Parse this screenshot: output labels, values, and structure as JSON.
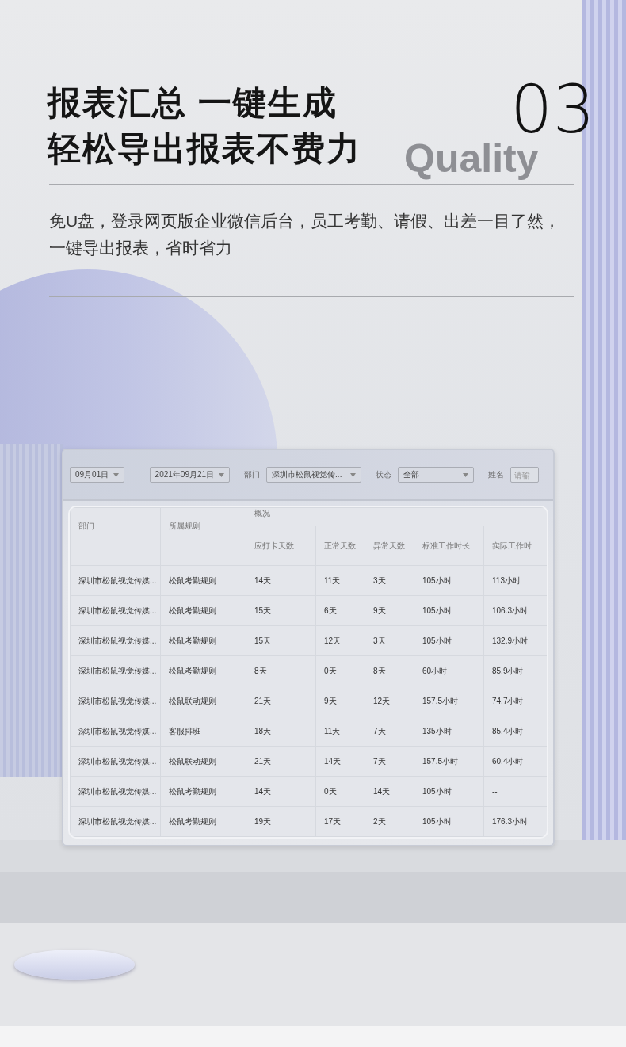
{
  "headline": {
    "lines": [
      "报表汇总 一键生成",
      "轻松导出报表不费力"
    ],
    "number": "03",
    "backdrop_word": "Quality"
  },
  "description": "免U盘，登录网页版企业微信后台，员工考勤、请假、出差一目了然，一键导出报表，省时省力",
  "filters": [
    {
      "kind": "select",
      "value": "09月01日"
    },
    {
      "kind": "separator",
      "text": "-"
    },
    {
      "kind": "select",
      "value": "2021年09月21日"
    },
    {
      "kind": "label",
      "text": "部门"
    },
    {
      "kind": "select",
      "value": "深圳市松鼠视觉传..."
    },
    {
      "kind": "label",
      "text": "状态"
    },
    {
      "kind": "select",
      "value": "全部"
    },
    {
      "kind": "label",
      "text": "姓名"
    },
    {
      "kind": "input",
      "placeholder": "请输"
    }
  ],
  "table": {
    "group_header": "概况",
    "columns": [
      "部门",
      "所属规则",
      "应打卡天数",
      "正常天数",
      "异常天数",
      "标准工作时长",
      "实际工作时"
    ],
    "rows": [
      [
        "深圳市松鼠视觉传媒...",
        "松鼠考勤规则",
        "14天",
        "11天",
        "3天",
        "105小时",
        "113小时"
      ],
      [
        "深圳市松鼠视觉传媒...",
        "松鼠考勤规则",
        "15天",
        "6天",
        "9天",
        "105小时",
        "106.3小时"
      ],
      [
        "深圳市松鼠视觉传媒...",
        "松鼠考勤规则",
        "15天",
        "12天",
        "3天",
        "105小时",
        "132.9小时"
      ],
      [
        "深圳市松鼠视觉传媒...",
        "松鼠考勤规则",
        "8天",
        "0天",
        "8天",
        "60小时",
        "85.9小时"
      ],
      [
        "深圳市松鼠视觉传媒...",
        "松鼠联动规则",
        "21天",
        "9天",
        "12天",
        "157.5小时",
        "74.7小时"
      ],
      [
        "深圳市松鼠视觉传媒...",
        "客服排班",
        "18天",
        "11天",
        "7天",
        "135小时",
        "85.4小时"
      ],
      [
        "深圳市松鼠视觉传媒...",
        "松鼠联动规则",
        "21天",
        "14天",
        "7天",
        "157.5小时",
        "60.4小时"
      ],
      [
        "深圳市松鼠视觉传媒...",
        "松鼠考勤规则",
        "14天",
        "0天",
        "14天",
        "105小时",
        "--"
      ],
      [
        "深圳市松鼠视觉传媒...",
        "松鼠考勤规则",
        "19天",
        "17天",
        "2天",
        "105小时",
        "176.3小时"
      ]
    ]
  }
}
